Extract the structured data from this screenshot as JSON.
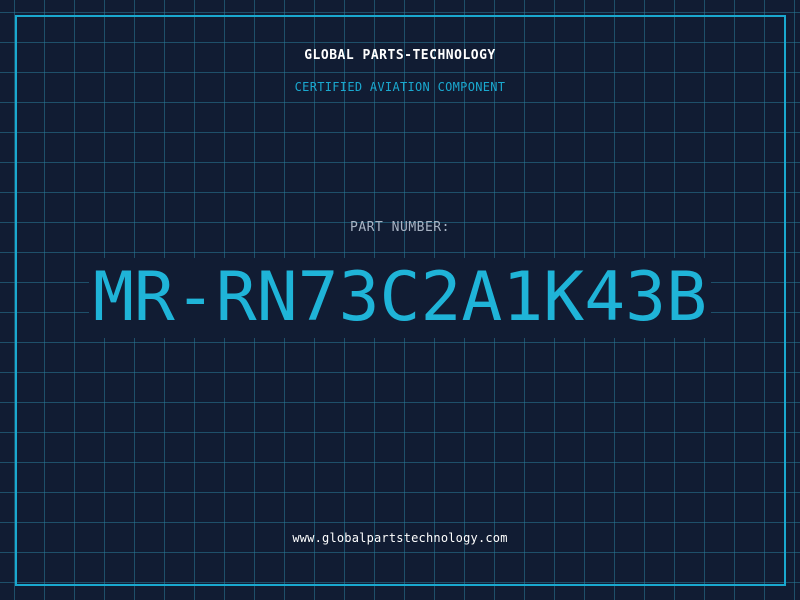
{
  "header": {
    "company": "GLOBAL PARTS-TECHNOLOGY",
    "tagline": "CERTIFIED AVIATION COMPONENT"
  },
  "part": {
    "label": "PART NUMBER:",
    "number": "MR-RN73C2A1K43B"
  },
  "footer": {
    "website": "www.globalpartstechnology.com"
  },
  "colors": {
    "background": "#111c33",
    "grid": "#287896",
    "accent": "#1aa8cf",
    "text": "#ffffff",
    "label": "#a9b4c4"
  }
}
